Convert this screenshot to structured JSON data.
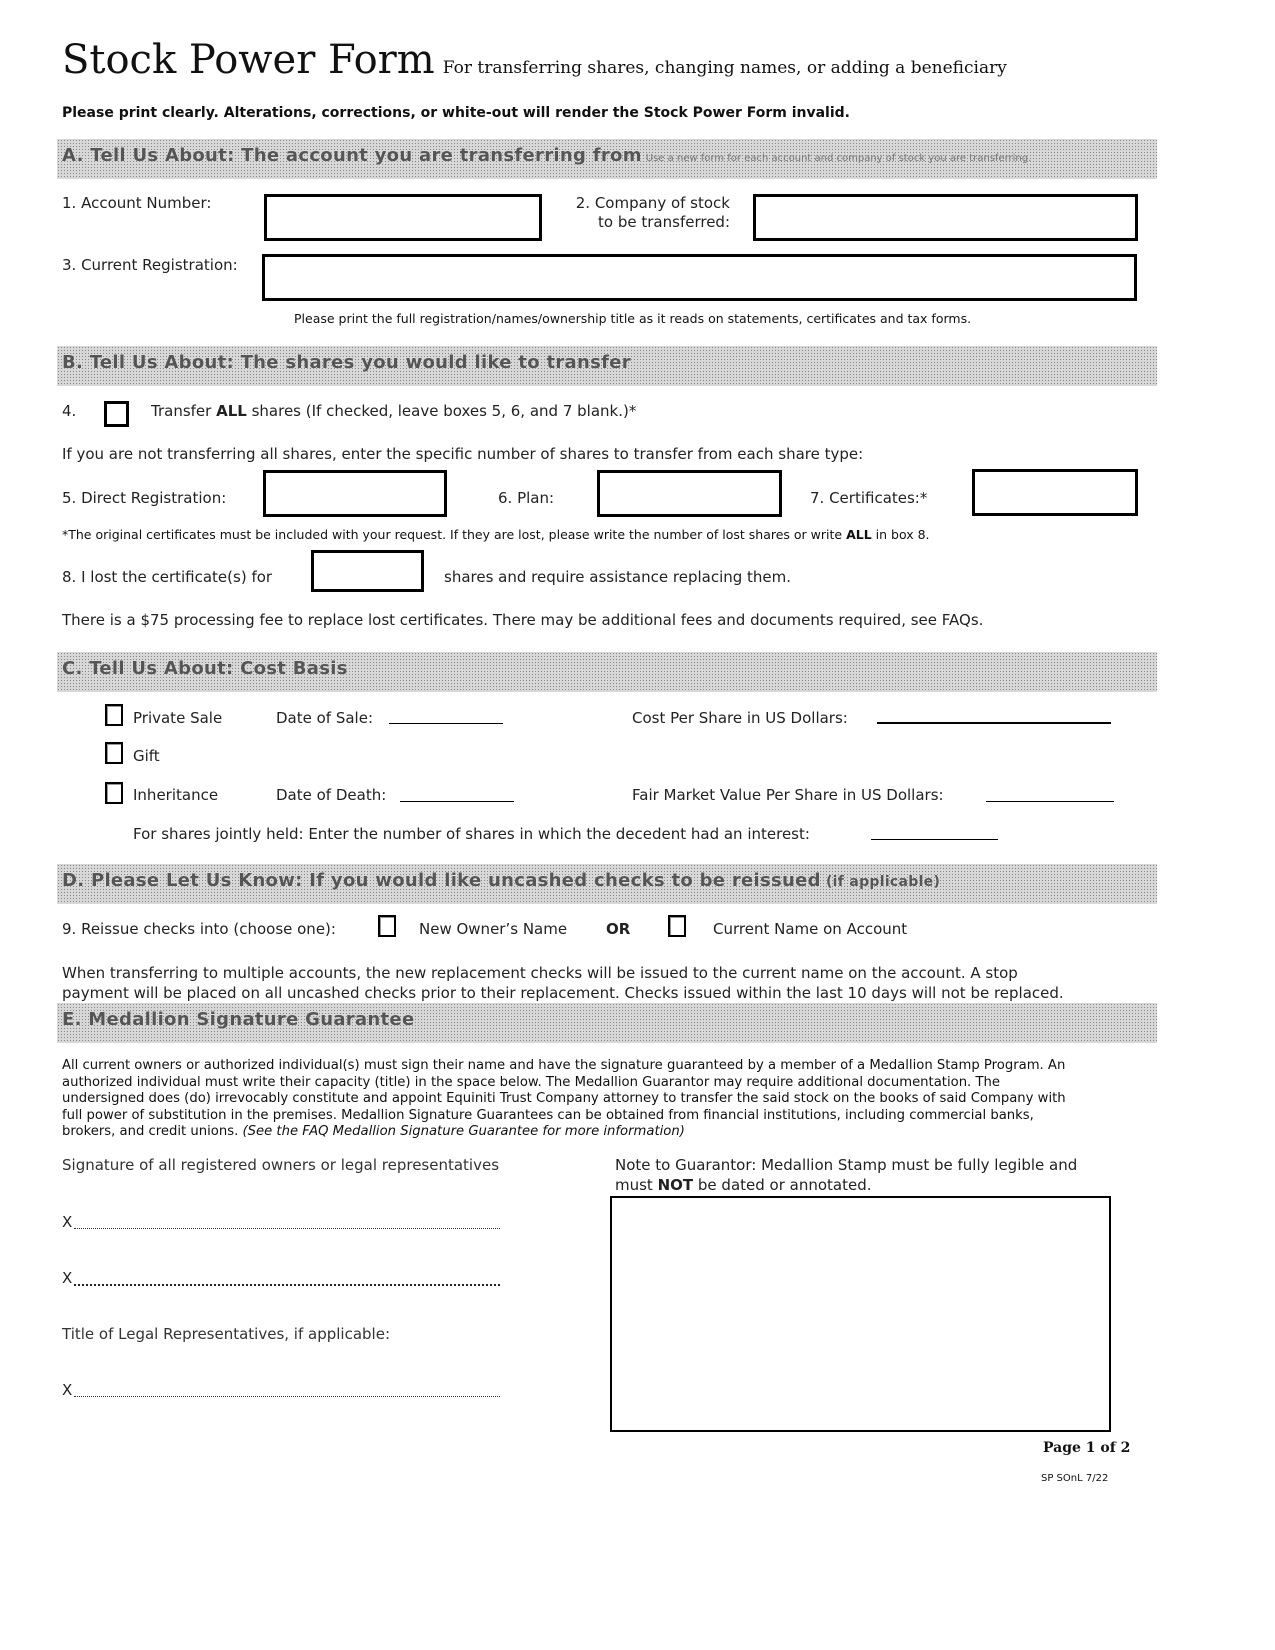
{
  "header": {
    "title": "Stock Power Form",
    "subtitle": "For transferring shares, changing names, or adding a beneficiary",
    "warning": "Please print clearly. Alterations, corrections, or white-out will render the Stock Power Form invalid."
  },
  "section_a": {
    "heading": "A. Tell Us About: The account you are transferring from",
    "note": "Use a new form for each account and company of stock you are transferring.",
    "account_number_label": "1. Account Number:",
    "account_number_value": "",
    "company_label_line1": "2. Company of stock",
    "company_label_line2": "to be transferred:",
    "company_value": "",
    "registration_label": "3. Current Registration:",
    "registration_value": "",
    "registration_help": "Please print the full registration/names/ownership title as it reads on statements, certificates and tax forms."
  },
  "section_b": {
    "heading": "B. Tell Us About: The shares you would like to transfer",
    "item4_number": "4.",
    "item4_pre": "Transfer ",
    "item4_bold": "ALL",
    "item4_post": " shares (If checked, leave boxes 5, 6, and 7 blank.)*",
    "item4_checked": false,
    "instruction": "If you are not transferring all shares, enter the specific number of shares to transfer from each share type:",
    "direct_label": "5. Direct Registration:",
    "plan_label": "6. Plan:",
    "certificates_label": "7. Certificates:*",
    "footnote_pre": "*The original certificates must be included with your request. If they are lost, please write the number of lost shares or write ",
    "footnote_bold": "ALL",
    "footnote_post": " in box 8.",
    "lost_pre": "8. I lost the certificate(s) for",
    "lost_post": "shares and require assistance replacing them.",
    "fee_note": "There is a $75 processing fee to replace lost certificates. There may be additional fees and documents required, see FAQs."
  },
  "section_c": {
    "heading": "C. Tell Us About: Cost Basis",
    "options": [
      {
        "label": "Private Sale",
        "checked": false
      },
      {
        "label": "Gift",
        "checked": false
      },
      {
        "label": "Inheritance",
        "checked": false
      }
    ],
    "date_of_sale_label": "Date of Sale:",
    "cost_per_share_label": "Cost Per Share in US Dollars:",
    "date_of_death_label": "Date of Death:",
    "fmv_label": "Fair Market Value Per Share in US Dollars:",
    "jointly_held_label": "For shares jointly held: Enter the number of shares in which the decedent had an interest:"
  },
  "section_d": {
    "heading": "D. Please Let Us Know: If you would like uncashed checks to be reissued",
    "heading_paren": "(if applicable)",
    "item9_label": "9. Reissue checks into (choose one):",
    "option_new": "New Owner’s Name",
    "or_label": "OR",
    "option_current": "Current Name on Account",
    "note_line1": "When transferring to multiple accounts, the new replacement checks will be issued to the current name on the account. A stop",
    "note_line2": "payment will be placed on all uncashed checks prior to their replacement. Checks issued within the last 10 days will not be replaced."
  },
  "section_e": {
    "heading": "E. Medallion Signature Guarantee",
    "paragraph_lines": [
      "All current owners or authorized individual(s) must sign their name and have the signature guaranteed by a member of a Medallion Stamp Program. An",
      "authorized individual must write their capacity (title) in the space below. The Medallion Guarantor may require additional documentation. The",
      "undersigned does (do) irrevocably constitute and appoint Equiniti Trust Company attorney to transfer the said stock on the books of said Company with",
      "full power of substitution in the premises. Medallion Signature Guarantees can be obtained from financial institutions, including commercial banks,"
    ],
    "paragraph_last_plain": "brokers, and credit unions. ",
    "paragraph_last_italic": "(See the FAQ Medallion Signature Guarantee for more information)",
    "signature_label": "Signature of all registered owners or legal representatives",
    "sign_x": "X",
    "title_label": "Title of Legal Representatives, if applicable:",
    "guarantor_note_line1": "Note to Guarantor: Medallion Stamp must be fully legible and",
    "guarantor_note_pre": "must ",
    "guarantor_note_bold": "NOT",
    "guarantor_note_post": " be dated or annotated."
  },
  "footer": {
    "page": "Page 1 of 2",
    "code": "SP SOnL 7/22"
  }
}
